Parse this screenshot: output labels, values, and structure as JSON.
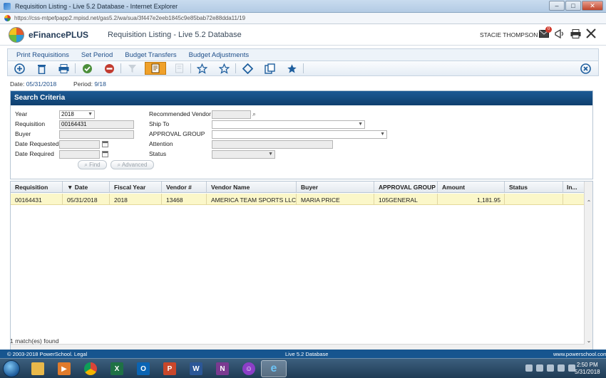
{
  "window": {
    "title": "Requisition Listing - Live 5.2 Database - Internet Explorer",
    "url": "https://css-mtpefpapp2.mpisd.net/gas5.2/wa/sua/3f447e2eeb1845c9e85bab72e88dda11/19",
    "btn_min": "–",
    "btn_max": "□",
    "btn_close": "✕"
  },
  "header": {
    "logo": "eFinancePLUS",
    "page_title": "Requisition Listing - Live 5.2 Database",
    "user": "STACIE THOMPSON",
    "mail_badge": "0",
    "icons": [
      "mail-icon",
      "megaphone-icon",
      "print-icon",
      "close-icon"
    ]
  },
  "menu": {
    "items": [
      "Print Requisitions",
      "Set Period",
      "Budget Transfers",
      "Budget Adjustments"
    ]
  },
  "toolbar": {
    "icons": [
      "add-icon",
      "delete-icon",
      "print-icon",
      "approve-icon",
      "deny-icon",
      "filter-icon",
      "requisition-icon",
      "document-icon",
      "star-outline-icon",
      "star-outline-icon",
      "diamond-icon",
      "copy-icon",
      "star-filled-icon",
      "close-circle-icon"
    ]
  },
  "context": {
    "date_label": "Date:",
    "date_value": "05/31/2018",
    "period_label": "Period:",
    "period_value": "9/18"
  },
  "search": {
    "title": "Search Criteria",
    "year_label": "Year",
    "year_value": "2018",
    "requisition_label": "Requisition",
    "requisition_value": "00164431",
    "buyer_label": "Buyer",
    "buyer_value": "",
    "date_requested_label": "Date Requested",
    "date_required_label": "Date Required",
    "recommended_vendor_label": "Recommended Vendor",
    "ship_to_label": "Ship To",
    "approval_group_label": "APPROVAL GROUP",
    "attention_label": "Attention",
    "status_label": "Status",
    "find_label": "Find",
    "advanced_label": "Advanced"
  },
  "grid": {
    "columns": [
      "Requisition",
      "▼ Date",
      "Fiscal Year",
      "Vendor #",
      "Vendor Name",
      "Buyer",
      "APPROVAL GROUP",
      "Amount",
      "Status",
      "In..."
    ],
    "rows": [
      [
        "00164431",
        "05/31/2018",
        "2018",
        "13468",
        "AMERICA TEAM SPORTS LLC",
        "MARIA PRICE",
        "105GENERAL",
        "1,181.95",
        "",
        ""
      ]
    ],
    "match_count": "1 match(es) found"
  },
  "footer": {
    "copyright": "© 2003-2018 PowerSchool. Legal",
    "database": "Live 5.2 Database",
    "site": "www.powerschool.com"
  },
  "taskbar": {
    "apps": [
      "file-explorer",
      "media-player",
      "chrome",
      "excel",
      "outlook",
      "powerpoint",
      "word",
      "onenote",
      "messenger",
      "internet-explorer"
    ],
    "time": "2:50 PM",
    "date": "5/31/2018"
  }
}
